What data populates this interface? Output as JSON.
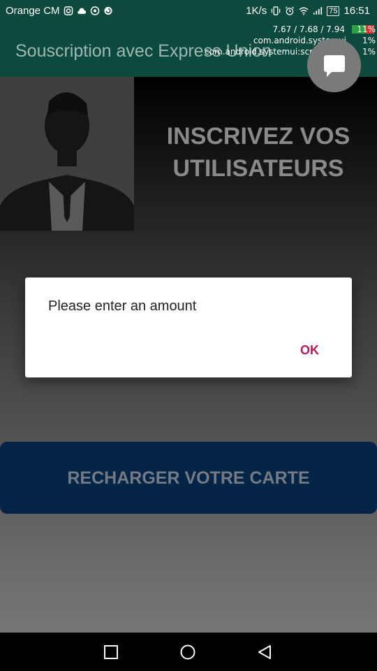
{
  "status_bar": {
    "carrier": "Orange CM",
    "net_speed": "1K/s",
    "battery": "75",
    "time": "16:51",
    "icons": [
      "instagram-icon",
      "cloud-icon",
      "chrome-icon",
      "sync-icon",
      "vibrate-icon",
      "alarm-icon",
      "wifi-icon",
      "signal-icon",
      "battery-icon"
    ]
  },
  "app_bar": {
    "title": "Souscription avec Express Union"
  },
  "overlay": {
    "load": "7.67 / 7.68 / 7.94",
    "load_pct": "11%",
    "proc1": "com.android.systemui",
    "proc1_pct": "1%",
    "proc2": "com.android.systemui:screenshot",
    "proc2_pct": "1%"
  },
  "fab": {
    "icon": "chat-icon"
  },
  "hero": {
    "line1": "INSCRIVEZ VOS",
    "line2": "UTILISATEURS"
  },
  "recharge": {
    "label": "RECHARGER VOTRE CARTE"
  },
  "dialog": {
    "message": "Please enter an amount",
    "ok_label": "OK"
  },
  "nav": {
    "icons": [
      "recent-apps-icon",
      "home-icon",
      "back-icon"
    ]
  },
  "colors": {
    "app_bar": "#0c4a3e",
    "dialog_accent": "#c2185b",
    "recharge_button": "#062546"
  }
}
